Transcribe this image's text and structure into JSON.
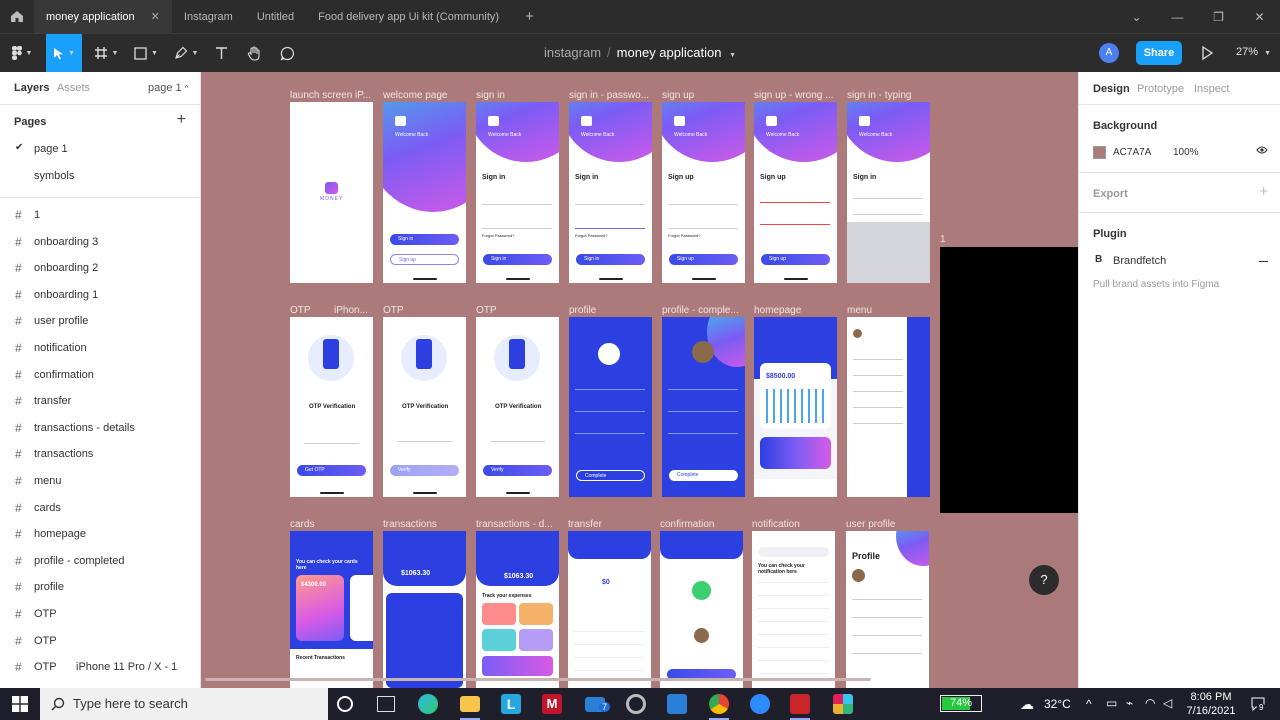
{
  "tabs": [
    {
      "label": "money application",
      "active": true,
      "close": "✕"
    },
    {
      "label": "Instagram",
      "active": false
    },
    {
      "label": "Untitled",
      "active": false
    },
    {
      "label": "Food delivery app Ui kit (Community)",
      "active": false
    }
  ],
  "toolbar": {
    "project": "instagram",
    "separator": "/",
    "file_name": "money application",
    "avatar_initial": "A",
    "share_label": "Share",
    "zoom": "27%"
  },
  "left_panel": {
    "tab_layers": "Layers",
    "tab_assets": "Assets",
    "current_page": "page 1",
    "pages_title": "Pages",
    "pages": [
      {
        "name": "page 1",
        "selected": true
      },
      {
        "name": "symbols",
        "selected": false
      }
    ],
    "layers": [
      "1",
      "onboarding 3",
      "onboarding 2",
      "onboarding 1",
      "user profile",
      "notification",
      "confirmation",
      "transfer",
      "transactions - details",
      "transactions",
      "menu",
      "cards",
      "homepage",
      "profile - completed",
      "profile",
      "OTP",
      "OTP",
      "OTP"
    ],
    "last_layer_extra": "iPhone 11 Pro / X - 1"
  },
  "right_panel": {
    "tabs": [
      "Design",
      "Prototype",
      "Inspect"
    ],
    "background_title": "Background",
    "background_hex": "AC7A7A",
    "background_opacity": "100%",
    "export_title": "Export",
    "plugin_title": "Plugin",
    "plugin_name": "Brandfetch",
    "plugin_desc": "Pull brand assets into Figma"
  },
  "canvas": {
    "background_color": "#ac7a7a",
    "row1_labels": [
      "launch screen iP...",
      "welcome page",
      "sign in",
      "sign in - passwo...",
      "sign up",
      "sign up - wrong ...",
      "sign in - typing"
    ],
    "row2_labels": [
      "OTP",
      "iPhon...",
      "OTP",
      "OTP",
      "profile",
      "profile - comple...",
      "homepage",
      "menu"
    ],
    "row3_labels": [
      "cards",
      "transactions",
      "transactions - d...",
      "transfer",
      "confirmation",
      "notification",
      "user profile"
    ],
    "extra_frame_label": "1",
    "frame_text": {
      "money": "MONEY",
      "welcome": "Welcome Back",
      "sign_in": "Sign in",
      "sign_up": "Sign up",
      "forgot": "Forgot Password?",
      "otp_title": "OTP Verification",
      "get_otp": "Get OTP",
      "verify": "Verify",
      "complete": "Complete",
      "profile": "Profile",
      "balance": "$8500.00",
      "expenses": "$1063.30",
      "card_amount": "$4300.00",
      "check_cards": "You can check your cards here",
      "check_notif": "You can check your notification here",
      "recent_tx": "Recent Transactions",
      "track": "Track your expenses",
      "confirm_amount": "$0"
    }
  },
  "help_button": "?",
  "taskbar": {
    "search_placeholder": "Type here to search",
    "battery": "74%",
    "battery_level": 0.74,
    "temperature": "32°C",
    "time": "8:06 PM",
    "date": "7/16/2021",
    "mail_badge": "7",
    "notif_badge": "9"
  }
}
